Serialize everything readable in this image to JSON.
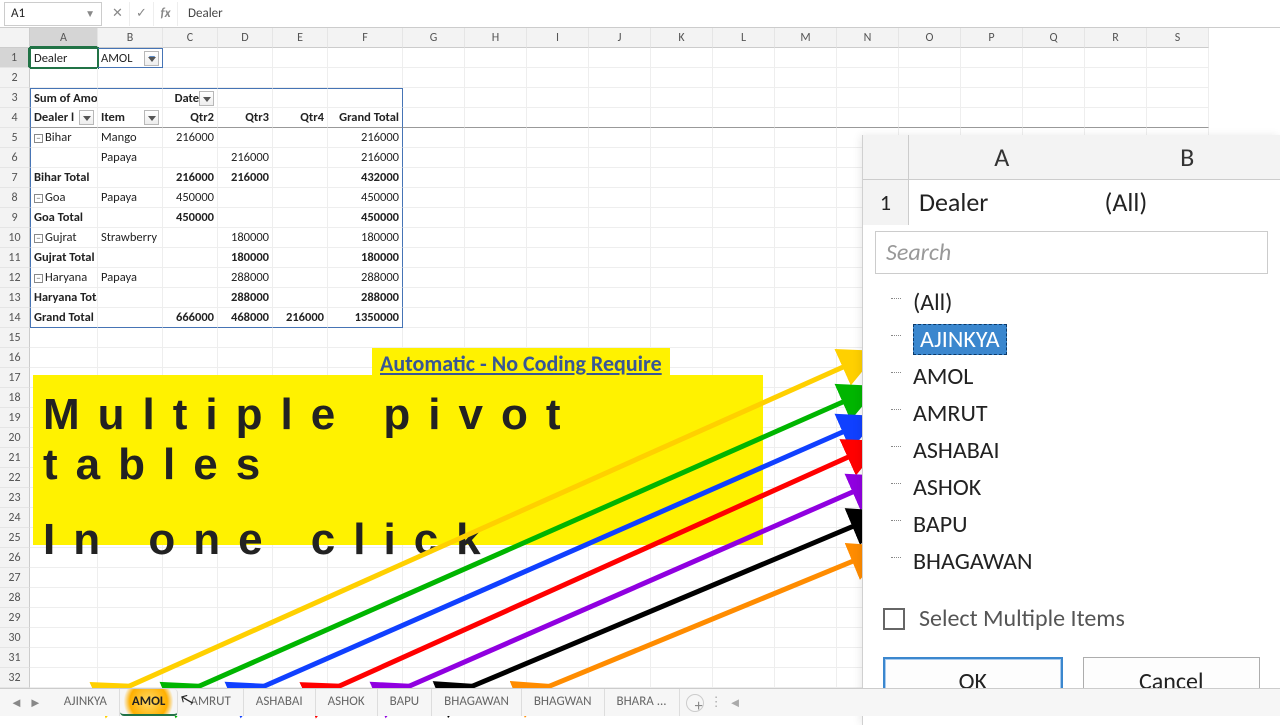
{
  "formula_bar": {
    "cell_ref": "A1",
    "value": "Dealer"
  },
  "col_letters": [
    "A",
    "B",
    "C",
    "D",
    "E",
    "F",
    "G",
    "H",
    "I",
    "J",
    "K",
    "L",
    "M",
    "N",
    "O",
    "P",
    "Q",
    "R",
    "S"
  ],
  "row1": {
    "A": "Dealer",
    "B": "AMOL"
  },
  "row3": {
    "A": "Sum of Amount",
    "C": "Date"
  },
  "row4": {
    "A": "Dealer l",
    "B": "Item",
    "C": "Qtr2",
    "D": "Qtr3",
    "E": "Qtr4",
    "F": "Grand Total"
  },
  "rows_data": [
    {
      "n": 5,
      "A": "Bihar",
      "B": "Mango",
      "C": "216000",
      "D": "",
      "E": "",
      "F": "216000",
      "exp": true
    },
    {
      "n": 6,
      "A": "",
      "B": "Papaya",
      "C": "",
      "D": "216000",
      "E": "",
      "F": "216000"
    },
    {
      "n": 7,
      "A": "Bihar Total",
      "C": "216000",
      "D": "216000",
      "E": "",
      "F": "432000",
      "total": true
    },
    {
      "n": 8,
      "A": "Goa",
      "B": "Papaya",
      "C": "450000",
      "D": "",
      "E": "",
      "F": "450000",
      "exp": true
    },
    {
      "n": 9,
      "A": "Goa Total",
      "C": "450000",
      "D": "",
      "E": "",
      "F": "450000",
      "total": true
    },
    {
      "n": 10,
      "A": "Gujrat",
      "B": "Strawberry",
      "C": "",
      "D": "180000",
      "E": "",
      "F": "180000",
      "exp": true
    },
    {
      "n": 11,
      "A": "Gujrat Total",
      "C": "",
      "D": "180000",
      "E": "",
      "F": "180000",
      "total": true
    },
    {
      "n": 12,
      "A": "Haryana",
      "B": "Papaya",
      "C": "",
      "D": "288000",
      "E": "",
      "F": "288000",
      "exp": true
    },
    {
      "n": 13,
      "A": "Haryana Total",
      "C": "",
      "D": "288000",
      "E": "",
      "F": "288000",
      "total": true
    },
    {
      "n": 14,
      "A": "Grand Total",
      "C": "666000",
      "D": "468000",
      "E": "216000",
      "F": "1350000",
      "total": true
    }
  ],
  "blank_rows": [
    15,
    16,
    17,
    18,
    19,
    20,
    21,
    22,
    23,
    24,
    25,
    26,
    27,
    28,
    29,
    30,
    31,
    32
  ],
  "overlay": {
    "subhead": "Automatic - No Coding Require",
    "line1": "Multiple pivot tables",
    "line2": "In one click"
  },
  "popup": {
    "colA": "A",
    "colB": "B",
    "row_num": "1",
    "field": "Dealer",
    "value": "(All)",
    "search_ph": "Search",
    "items": [
      "(All)",
      "AJINKYA",
      "AMOL",
      "AMRUT",
      "ASHABAI",
      "ASHOK",
      "BAPU",
      "BHAGAWAN"
    ],
    "selected": "AJINKYA",
    "multi": "Select Multiple Items",
    "ok": "OK",
    "cancel": "Cancel"
  },
  "tabs": [
    "AJINKYA",
    "AMOL",
    "AMRUT",
    "ASHABAI",
    "ASHOK",
    "BAPU",
    "BHAGAWAN",
    "BHAGWAN",
    "BHARA ..."
  ],
  "active_tab": "AMOL"
}
